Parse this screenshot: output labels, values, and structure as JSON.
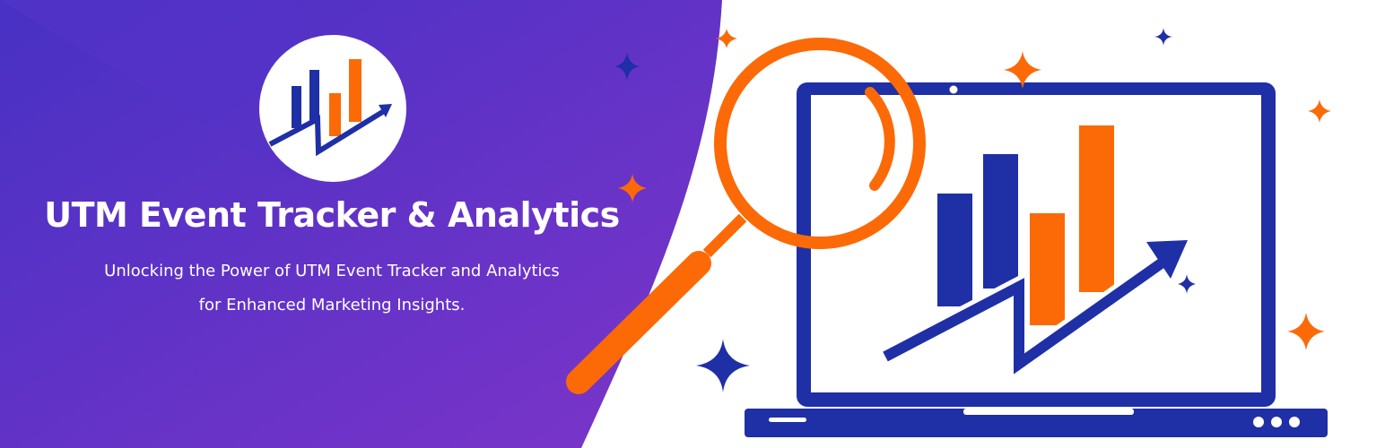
{
  "banner": {
    "title": "UTM Event Tracker & Analytics",
    "subtitle_line1": "Unlocking the Power of UTM Event Tracker and Analytics",
    "subtitle_line2": "for Enhanced Marketing Insights."
  },
  "icons": [
    "bar-chart-logo-icon",
    "magnifying-glass-icon",
    "laptop-icon",
    "growth-arrow-icon",
    "sparkle-star-icon"
  ],
  "colors": {
    "purple_dark": "#4a2ec2",
    "purple_light": "#7f35c8",
    "blue": "#1f2fa6",
    "orange": "#fb6a07",
    "white": "#ffffff"
  }
}
